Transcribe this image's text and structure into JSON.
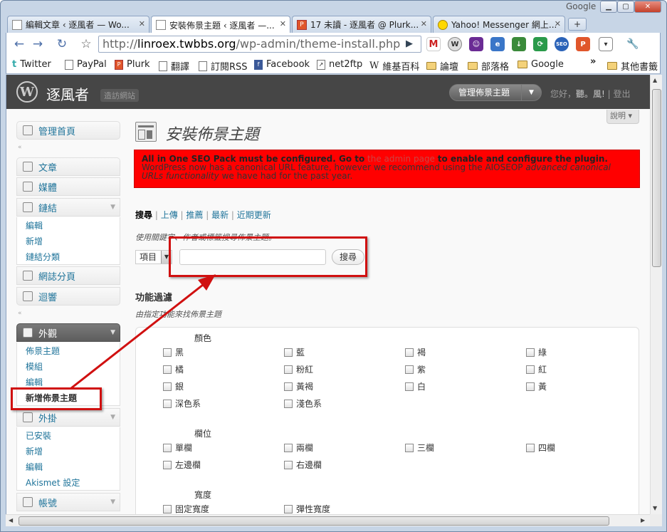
{
  "browser": {
    "google_label": "Google",
    "tabs": [
      {
        "label": "編輯文章 ‹ 逐風者 — Wo...",
        "active": false
      },
      {
        "label": "安裝佈景主題 ‹ 逐風者 —...",
        "active": true
      },
      {
        "label": "17 未讀 - 逐風者 @ Plurk...",
        "active": false
      },
      {
        "label": "Yahoo! Messenger 網上...",
        "active": false
      }
    ],
    "url_scheme": "http://",
    "url_host": "linroex.twbbs.org",
    "url_path": "/wp-admin/theme-install.php",
    "bookmarks": [
      "Twitter",
      "PayPal",
      "Plurk",
      "翻譯",
      "訂閱RSS",
      "Facebook",
      "net2ftp",
      "維基百科",
      "論壇",
      "部落格",
      "Google"
    ],
    "other_bookmarks": "其他書籤",
    "more_bookmarks": "»"
  },
  "wp": {
    "site_name": "逐風者",
    "visit_site": "造訪網站",
    "manage_themes": "管理佈景主題",
    "greeting": "您好，",
    "user": "聽。風!",
    "logout": "登出",
    "help": "說明 ▾"
  },
  "sidebar": {
    "dashboard": "管理首頁",
    "posts": "文章",
    "media": "媒體",
    "links": "鏈結",
    "links_sub": [
      "編輯",
      "新增",
      "鏈結分類"
    ],
    "pages": "網誌分頁",
    "comments": "迴響",
    "appearance": "外觀",
    "appearance_sub": [
      "佈景主題",
      "模組",
      "編輯",
      "新增佈景主題"
    ],
    "plugins": "外掛",
    "plugins_sub": [
      "已安裝",
      "新增",
      "編輯",
      "Akismet 設定"
    ],
    "users": "帳號"
  },
  "main": {
    "title": "安裝佈景主題",
    "notice_bold1": "All in One SEO Pack must be configured. Go to",
    "notice_link": "the admin page",
    "notice_bold2": "to enable and configure the plugin.",
    "notice_line2a": "WordPress now has a canonical URL feature, however we recommend using the AIOSEOP",
    "notice_line2b": "advanced canonical URLs functionality",
    "notice_line2c": "we have had for the past year.",
    "subnav": [
      "搜尋",
      "上傳",
      "推薦",
      "最新",
      "近期更新"
    ],
    "search_hint": "使用關鍵字、作者或標籤搜尋佈景主題。",
    "search_type": "項目",
    "search_button": "搜尋",
    "filter_title": "功能過濾",
    "filter_hint": "由指定功能來找佈景主題",
    "color_head": "顏色",
    "colors": [
      "黑",
      "藍",
      "褐",
      "綠",
      "橘",
      "粉紅",
      "紫",
      "紅",
      "銀",
      "黃褐",
      "白",
      "黃",
      "深色系",
      "淺色系"
    ],
    "columns_head": "欄位",
    "columns": [
      "單欄",
      "兩欄",
      "三欄",
      "四欄",
      "左邊欄",
      "右邊欄"
    ],
    "width_head": "寬度",
    "widths": [
      "固定寬度",
      "彈性寬度"
    ]
  }
}
